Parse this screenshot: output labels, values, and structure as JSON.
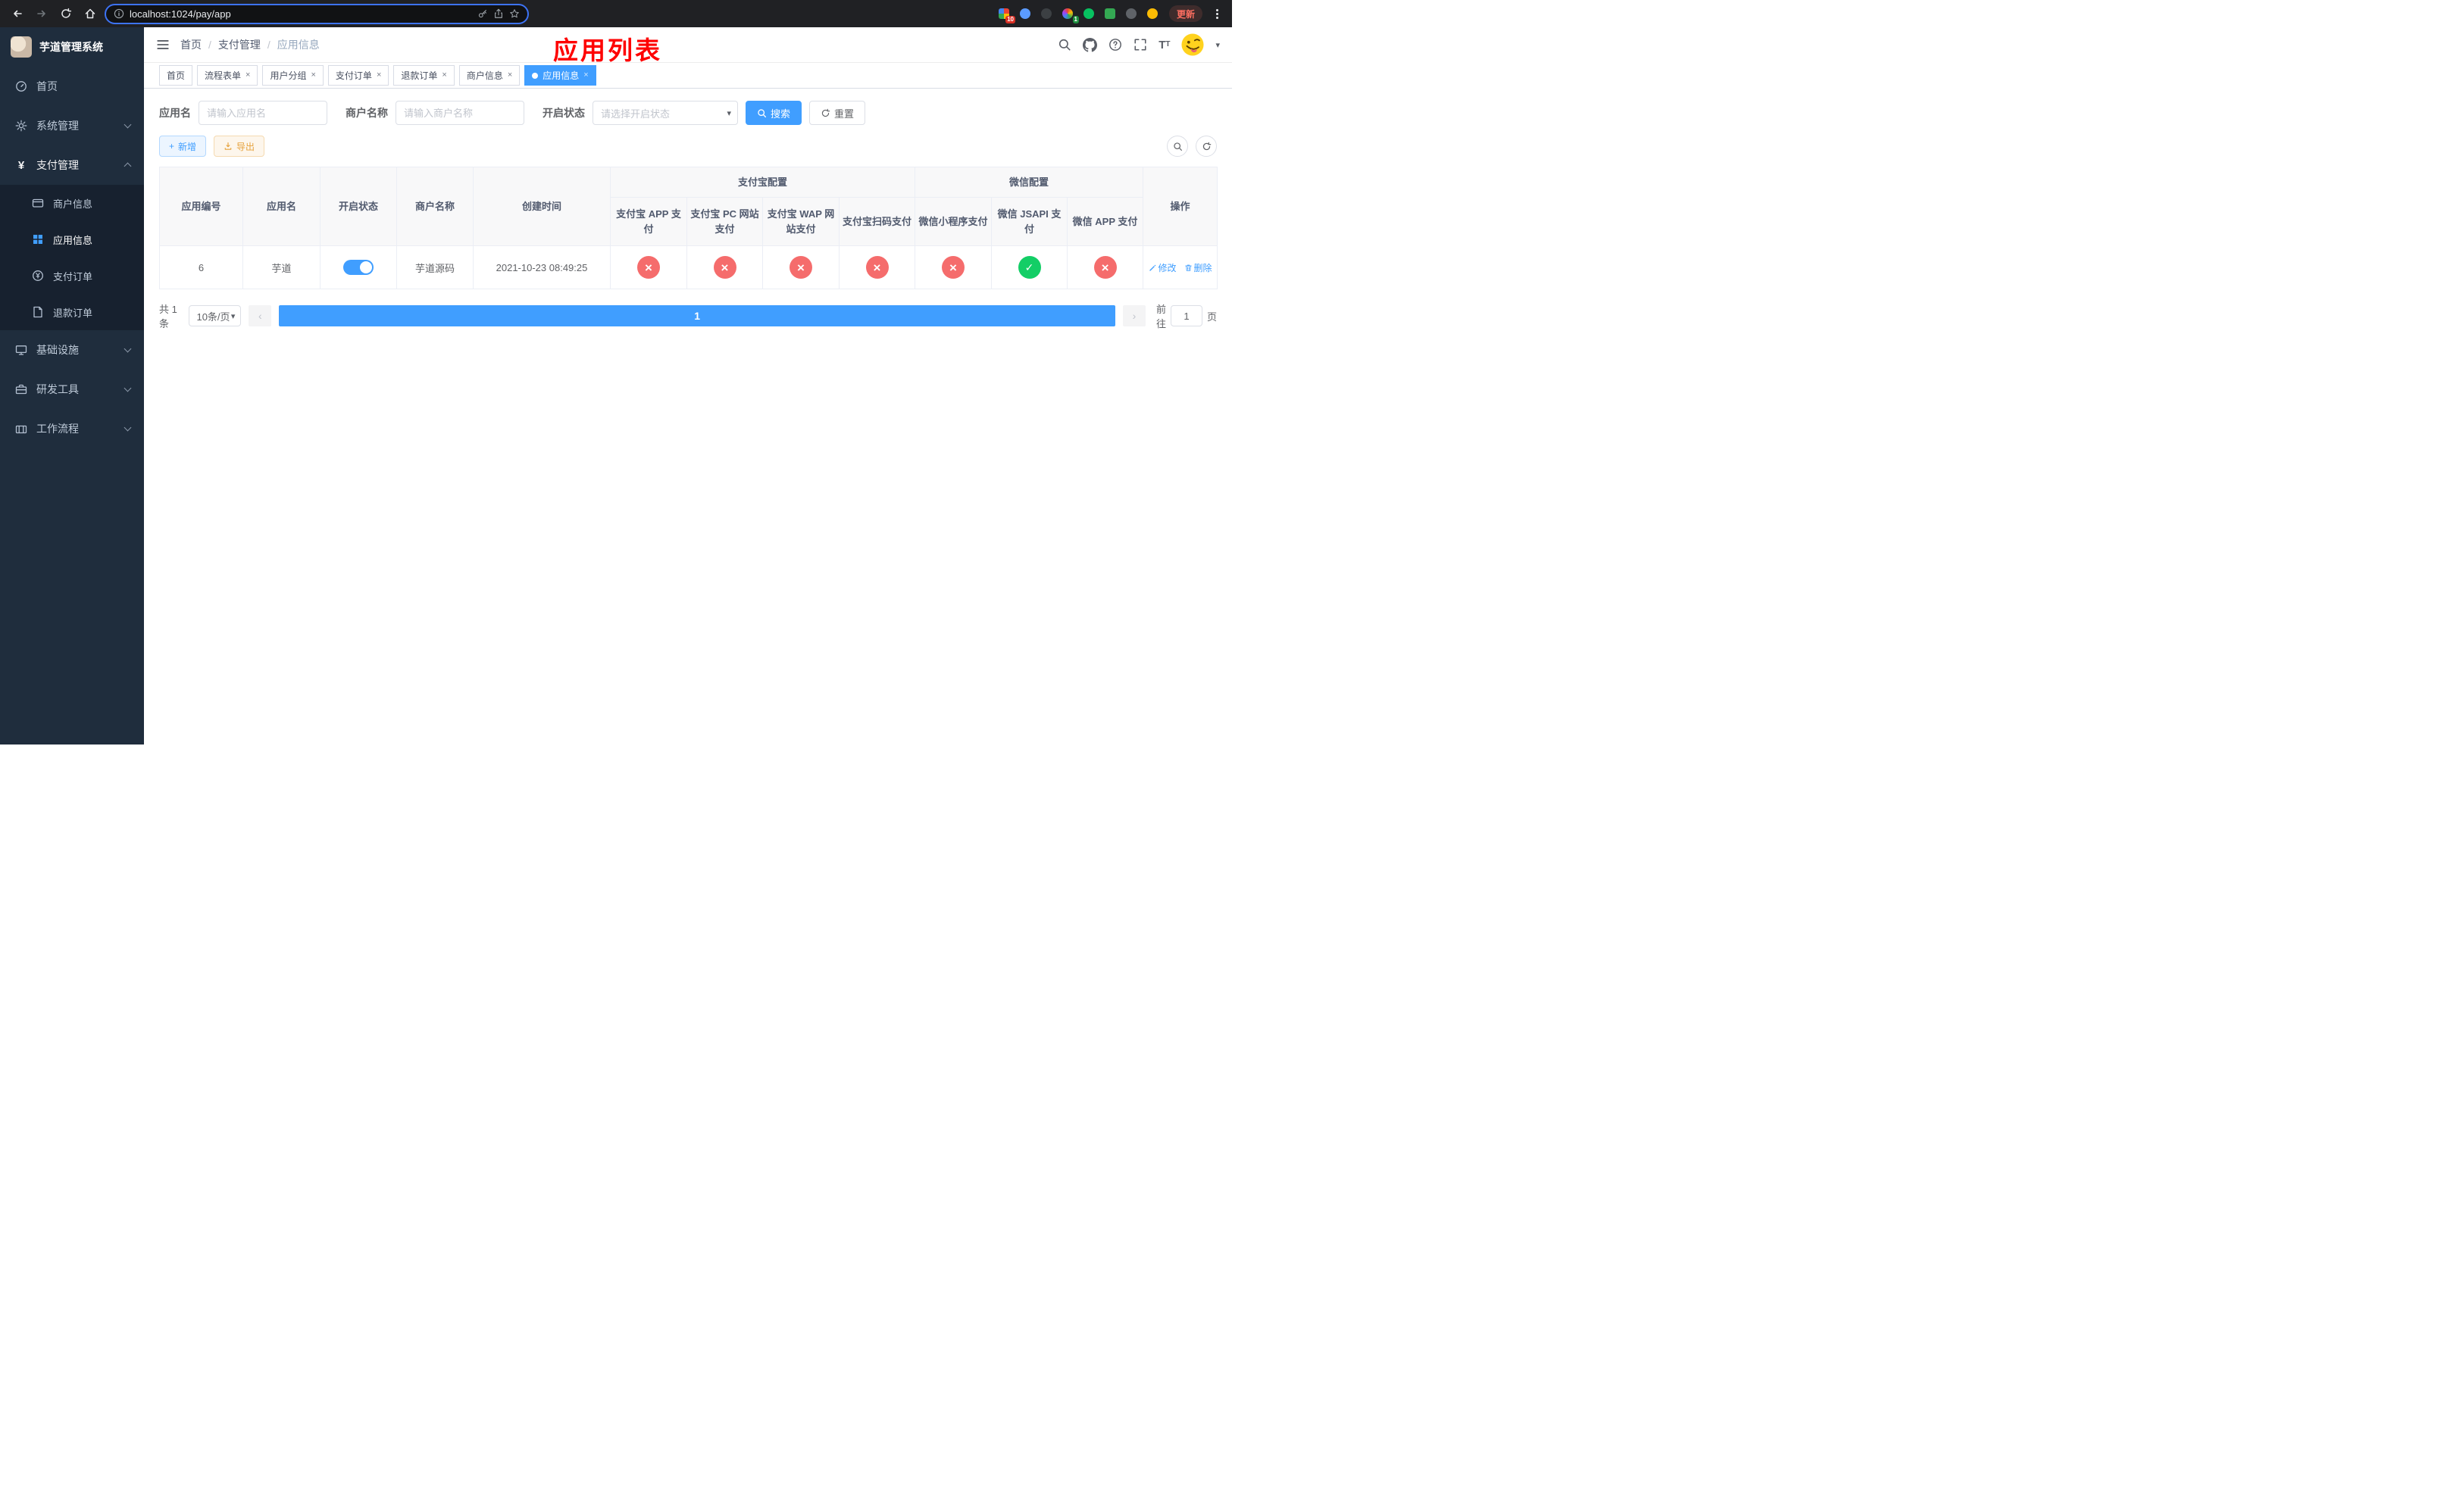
{
  "colors": {
    "accent": "#409eff",
    "success": "#13ce66",
    "danger": "#f56c6c",
    "warning": "#e6a23c",
    "annotation_red": "#fe0000",
    "sidebar_bg": "#1f2d3d"
  },
  "browser": {
    "url": "localhost:1024/pay/app",
    "update_label": "更新",
    "badge_tabs": "10",
    "badge_ext": "1"
  },
  "sidebar": {
    "title": "芋道管理系统",
    "items": [
      {
        "label": "首页"
      },
      {
        "label": "系统管理"
      },
      {
        "label": "支付管理"
      },
      {
        "label": "基础设施"
      },
      {
        "label": "研发工具"
      },
      {
        "label": "工作流程"
      }
    ],
    "payment_children": [
      {
        "label": "商户信息"
      },
      {
        "label": "应用信息",
        "active": true
      },
      {
        "label": "支付订单"
      },
      {
        "label": "退款订单"
      }
    ]
  },
  "header": {
    "breadcrumb": [
      "首页",
      "支付管理",
      "应用信息"
    ],
    "separator": "/",
    "annotation": "应用列表"
  },
  "tabs": [
    {
      "label": "首页",
      "closable": false
    },
    {
      "label": "流程表单",
      "closable": true
    },
    {
      "label": "用户分组",
      "closable": true
    },
    {
      "label": "支付订单",
      "closable": true
    },
    {
      "label": "退款订单",
      "closable": true
    },
    {
      "label": "商户信息",
      "closable": true
    },
    {
      "label": "应用信息",
      "closable": true,
      "active": true
    }
  ],
  "filters": {
    "app_name_label": "应用名",
    "app_name_placeholder": "请输入应用名",
    "merchant_label": "商户名称",
    "merchant_placeholder": "请输入商户名称",
    "status_label": "开启状态",
    "status_placeholder": "请选择开启状态",
    "search_label": "搜索",
    "reset_label": "重置"
  },
  "toolbar": {
    "add_label": "新增",
    "export_label": "导出"
  },
  "table": {
    "col_app_id": "应用编号",
    "col_app_name": "应用名",
    "col_status": "开启状态",
    "col_merchant": "商户名称",
    "col_created": "创建时间",
    "alipay_group_label": "支付宝配置",
    "wechat_group_label": "微信配置",
    "col_alipay_app": "支付宝 APP 支付",
    "col_alipay_pc": "支付宝 PC 网站支付",
    "col_alipay_wap": "支付宝 WAP 网站支付",
    "col_alipay_qr": "支付宝扫码支付",
    "col_wx_lite": "微信小程序支付",
    "col_wx_jsapi": "微信 JSAPI 支付",
    "col_wx_app": "微信 APP 支付",
    "col_actions": "操作",
    "rows": [
      {
        "app_id": "6",
        "app_name": "芋道",
        "enabled": true,
        "merchant": "芋道源码",
        "created_at": "2021-10-23 08:49:25",
        "alipay_app": false,
        "alipay_pc": false,
        "alipay_wap": false,
        "alipay_qr": false,
        "wx_lite": false,
        "wx_jsapi": true,
        "wx_app": false,
        "edit_label": "修改",
        "delete_label": "删除"
      }
    ]
  },
  "pagination": {
    "total_label": "共 1 条",
    "page_size_label": "10条/页",
    "page": "1",
    "goto_label": "前往",
    "goto_value": "1",
    "page_unit": "页"
  }
}
